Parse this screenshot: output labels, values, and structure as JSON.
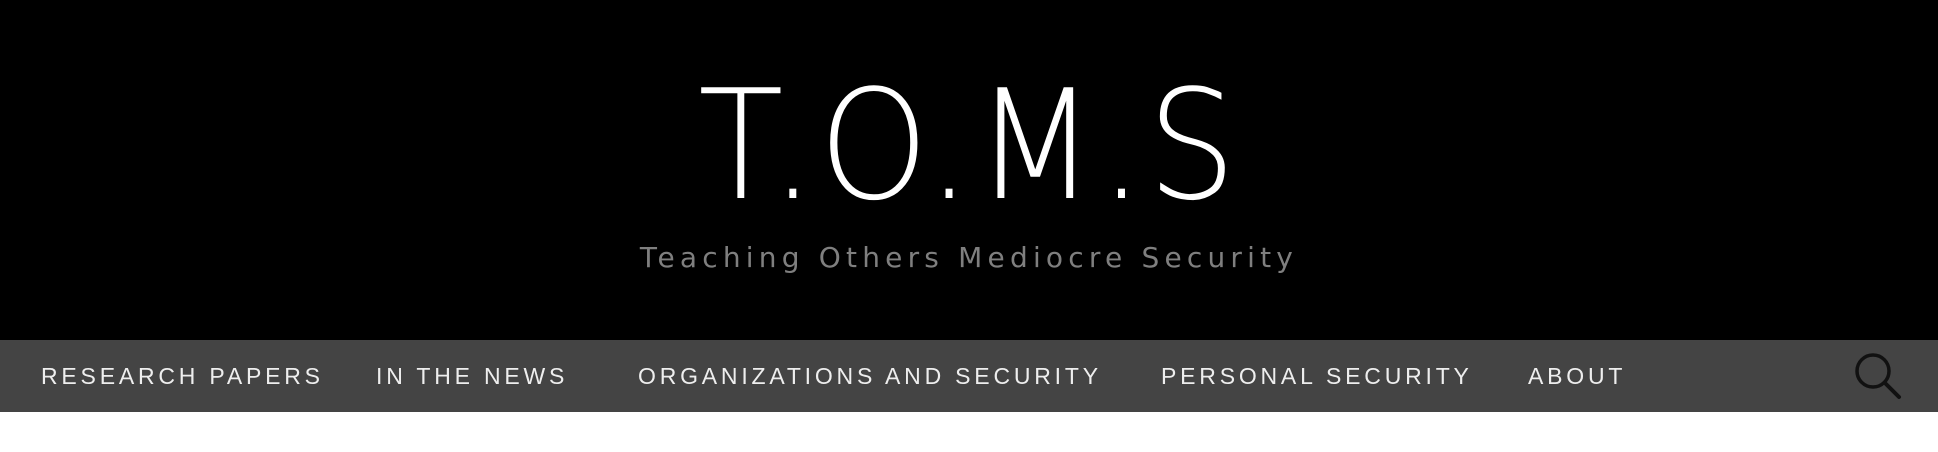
{
  "site": {
    "title": "T.O.M.S",
    "tagline": "Teaching Others Mediocre Security"
  },
  "nav": {
    "items": [
      {
        "label": "RESEARCH PAPERS"
      },
      {
        "label": "IN THE NEWS"
      },
      {
        "label": "ORGANIZATIONS AND SECURITY"
      },
      {
        "label": "PERSONAL SECURITY"
      },
      {
        "label": "ABOUT"
      }
    ],
    "search_icon": "search-icon"
  },
  "colors": {
    "header_bg": "#000000",
    "nav_bg": "#444444",
    "title": "#ffffff",
    "tagline": "#7f7f7f",
    "nav_text": "#eeeeee",
    "search_icon": "#111111"
  }
}
